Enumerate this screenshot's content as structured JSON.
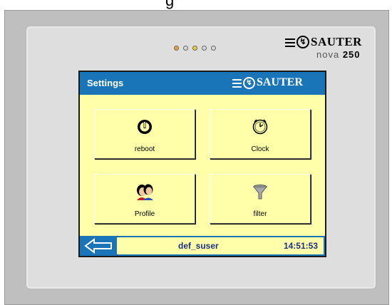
{
  "top_text": "g",
  "device": {
    "brand_name": "SAUTER",
    "model_prefix": "nova",
    "model_number": "250",
    "leds": [
      {
        "color": "#f0a030"
      },
      {
        "color": "#d8d8d8"
      },
      {
        "color": "#f0d020"
      },
      {
        "color": "#d8d8d8"
      },
      {
        "color": "#d8d8d8"
      }
    ]
  },
  "screen": {
    "title": "Settings",
    "brand_name": "SAUTER",
    "tiles": [
      {
        "label": "reboot",
        "icon": "power-icon"
      },
      {
        "label": "Clock",
        "icon": "clock-icon"
      },
      {
        "label": "Profile",
        "icon": "profile-icon"
      },
      {
        "label": "filter",
        "icon": "filter-icon"
      }
    ],
    "status": {
      "user": "def_suser",
      "time": "14:51:53",
      "back_icon": "back-arrow-icon"
    }
  },
  "colors": {
    "title_bar": "#1a75b8",
    "screen_bg": "#ffffaa",
    "status_text": "#1a3080"
  }
}
